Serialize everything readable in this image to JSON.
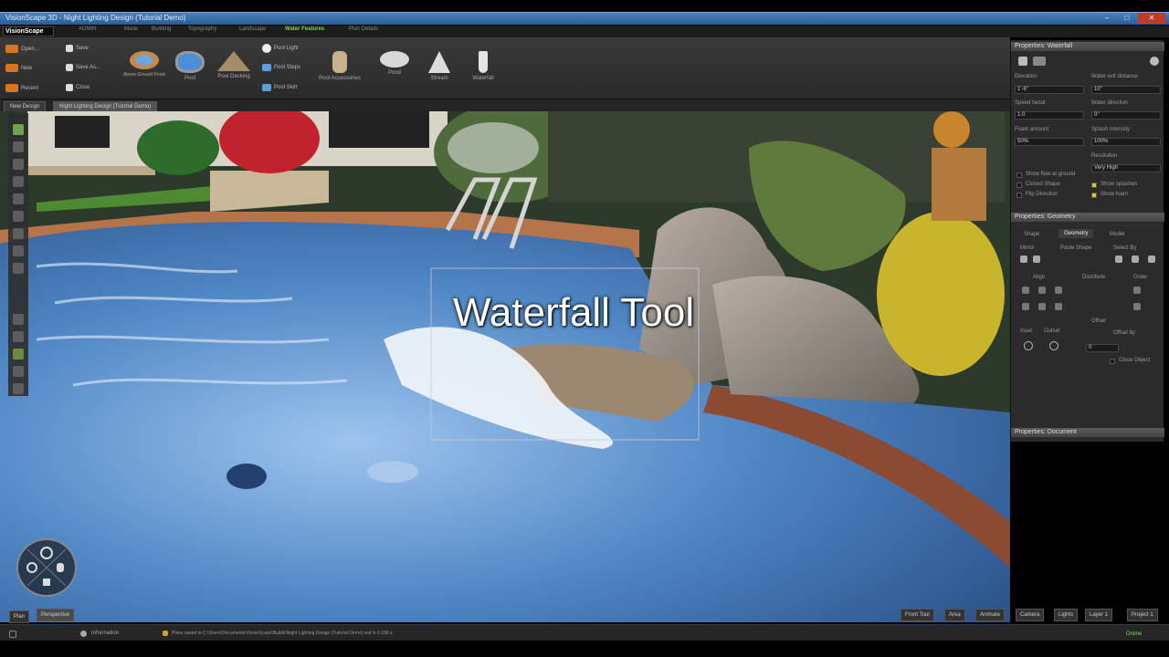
{
  "window": {
    "title": "VisionScape 3D - Night Lighting Design (Tutorial Demo)",
    "minimize": "–",
    "maximize": "□",
    "close": "✕"
  },
  "menu": {
    "logo": "VisionScape",
    "tabs": [
      "ADMIN",
      "Mode",
      "Building",
      "Topography",
      "Landscape",
      "Water Features",
      "Plan Details"
    ],
    "active_tab": "Water Features"
  },
  "ribbon": {
    "file": [
      "Open...",
      "New",
      "Recent"
    ],
    "doc": [
      "Save",
      "Save As...",
      "Close"
    ],
    "tools": [
      "Above Ground Pools",
      "Pool",
      "Pool Decking",
      "Pool Accessories",
      "Pond",
      "Stream",
      "Waterfall"
    ],
    "pool_parts": [
      "Pool Light",
      "Pool Steps",
      "Pool Skirt"
    ]
  },
  "doctabs": [
    "New Design",
    "Night Lighting Design (Tutorial Demo)"
  ],
  "caption": "Waterfall Tool",
  "properties": {
    "header": "Properties: Waterfall",
    "fields": [
      {
        "label": "Elevation",
        "value": "1'-6\""
      },
      {
        "label": "Water exit distance",
        "value": "10\""
      },
      {
        "label": "Speed factor",
        "value": "1.0"
      },
      {
        "label": "Water direction",
        "value": "0°"
      },
      {
        "label": "Foam amount",
        "value": "50%"
      },
      {
        "label": "Splash intensity",
        "value": "100%"
      }
    ],
    "resolution_label": "Resolution",
    "resolution_value": "Very High",
    "checks_left": [
      "Show flow at ground",
      "Closed Shape",
      "Flip Direction"
    ],
    "checks_right": [
      "Show splashes",
      "Show foam"
    ],
    "geometry_header": "Properties: Geometry",
    "geo_tabs": [
      "Shape",
      "Geometry",
      "Model"
    ],
    "geo_labels": [
      "Mirror",
      "Paste Shape",
      "Select By",
      "Align",
      "Distribute",
      "Order",
      "Offset",
      "Inset",
      "Outset",
      "Offset by:"
    ],
    "offset_value": "0",
    "close_object": "Close Object",
    "document_header": "Properties: Document"
  },
  "viewtabs": [
    "Plan",
    "Perspective"
  ],
  "view_buttons": [
    "Front Tour",
    "Area",
    "Animate",
    "Camera",
    "Lights",
    "Layer 1",
    "Project 1"
  ],
  "status": {
    "information": "Information",
    "message": "Plans saved to C:\\Users\\Documents\\VisionScape\\Builds\\Night Lighting Design (Tutorial Demo).vsd in 0.158 s",
    "right": "Online"
  },
  "colors": {
    "accent": "#7fd35a",
    "water": "#3f6fa8"
  }
}
